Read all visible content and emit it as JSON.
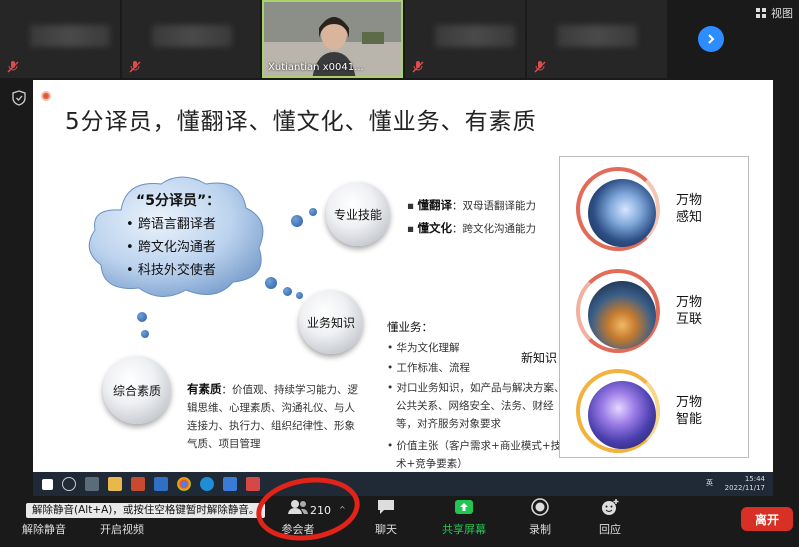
{
  "gallery": {
    "speaker_name": "Xutiantian x0041...",
    "view_label": "视图"
  },
  "slide": {
    "title": "5分译员，懂翻译、懂文化、懂业务、有素质",
    "cloud": {
      "heading": "“5分译员”：",
      "items": [
        "跨语言翻译者",
        "跨文化沟通者",
        "科技外交使者"
      ]
    },
    "spheres": {
      "skill": "专业技能",
      "business": "业务知识",
      "quality": "综合素质"
    },
    "skill_lines": [
      {
        "key": "懂翻译",
        "value": "：双母语翻译能力"
      },
      {
        "key": "懂文化",
        "value": "：跨文化沟通能力"
      }
    ],
    "business": {
      "heading": "懂业务：",
      "items": [
        "华为文化理解",
        "工作标准、流程",
        "对口业务知识，如产品与解决方案、公共关系、网络安全、法务、财经等，对齐服务对象要求",
        "价值主张（客户需求+商业模式+技术+竞争要素）"
      ]
    },
    "quality": {
      "key": "有素质",
      "value": "：价值观、持续学习能力、逻辑思维、心理素质、沟通礼仪、与人连接力、执行力、组织纪律性、形象气质、项目管理"
    },
    "new_knowledge": "新知识",
    "right_items": [
      {
        "l1": "万物",
        "l2": "感知"
      },
      {
        "l1": "万物",
        "l2": "互联"
      },
      {
        "l1": "万物",
        "l2": "智能"
      }
    ]
  },
  "taskbar": {
    "time": "15:44",
    "date": "2022/11/17",
    "lang": "英"
  },
  "toolbar": {
    "tooltip": "解除静音(Alt+A)，或按住空格键暂时解除静音。",
    "unmute": "解除静音",
    "video": "开启视频",
    "participants": "参会者",
    "participant_count": "210",
    "chat": "聊天",
    "share": "共享屏幕",
    "record": "录制",
    "reactions": "回应",
    "leave": "离开"
  },
  "colors": {
    "accent_blue": "#2d8cff",
    "share_green": "#23c552",
    "leave_red": "#d93025",
    "annotation_red": "#e2231a"
  }
}
